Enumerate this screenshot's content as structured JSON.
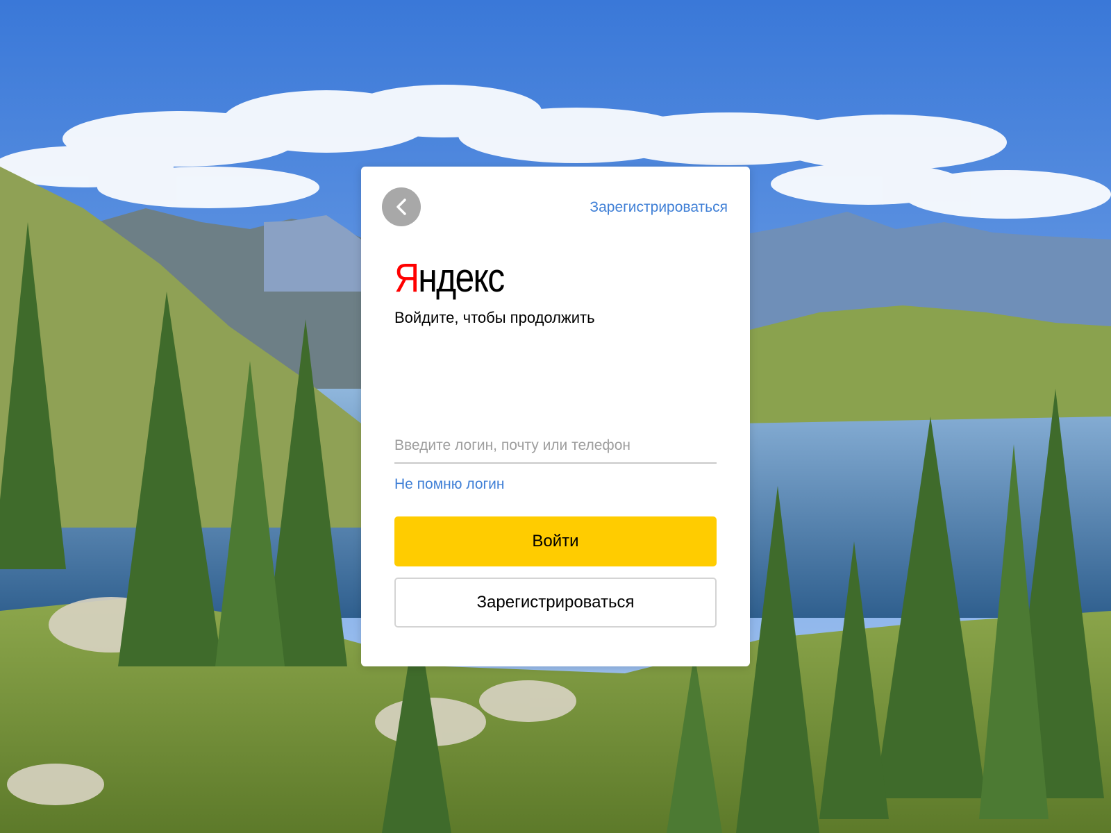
{
  "header": {
    "back_icon": "chevron-left-icon",
    "register_link": "Зарегистрироваться"
  },
  "logo": {
    "first_letter": "Я",
    "rest": "ндекс"
  },
  "subtitle": "Войдите, чтобы продолжить",
  "login": {
    "value": "",
    "placeholder": "Введите логин, почту или телефон"
  },
  "forgot_login": "Не помню логин",
  "buttons": {
    "login": "Войти",
    "register": "Зарегистрироваться"
  },
  "colors": {
    "brand_red": "#ff0000",
    "accent_yellow": "#ffcc00",
    "link_blue": "#3f7fd6",
    "back_button_gray": "#a8a8a8"
  },
  "background": {
    "description": "mountain lake landscape"
  }
}
